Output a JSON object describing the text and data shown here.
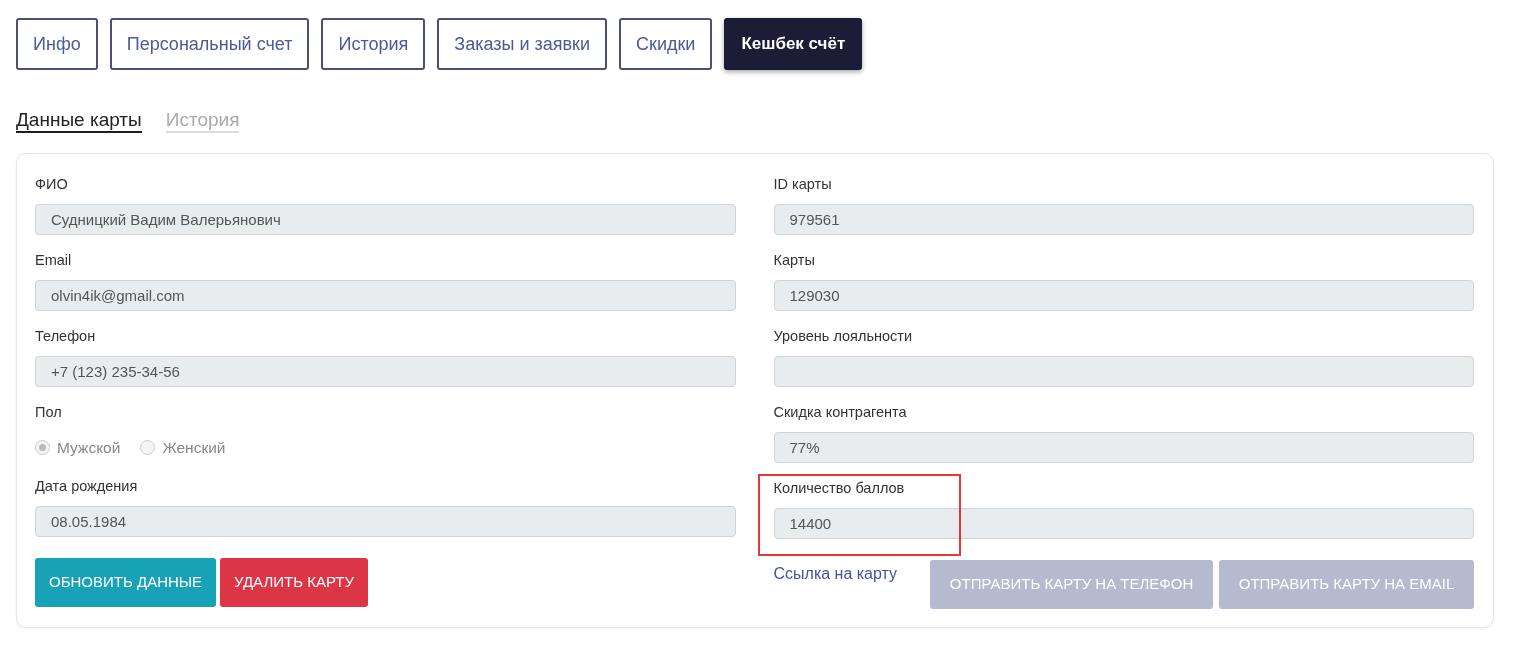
{
  "tabs": [
    {
      "label": "Инфо",
      "selected": false
    },
    {
      "label": "Персональный счет",
      "selected": false
    },
    {
      "label": "История",
      "selected": false
    },
    {
      "label": "Заказы и заявки",
      "selected": false
    },
    {
      "label": "Скидки",
      "selected": false
    },
    {
      "label": "Кешбек счёт",
      "selected": true
    }
  ],
  "subtabs": [
    {
      "label": "Данные карты",
      "selected": true
    },
    {
      "label": "История",
      "selected": false
    }
  ],
  "left_fields": [
    {
      "kind": "text",
      "label": "ФИО",
      "value": "Судницкий Вадим Валерьянович"
    },
    {
      "kind": "text",
      "label": "Email",
      "value": "olvin4ik@gmail.com"
    },
    {
      "kind": "text",
      "label": "Телефон",
      "value": "+7 (123) 235-34-56"
    },
    {
      "kind": "radio",
      "label": "Пол",
      "disabled": true,
      "options": [
        {
          "label": "Мужской",
          "selected": true
        },
        {
          "label": "Женский",
          "selected": false
        }
      ]
    },
    {
      "kind": "text",
      "label": "Дата рождения",
      "value": "08.05.1984"
    }
  ],
  "right_fields": [
    {
      "kind": "text",
      "label": "ID карты",
      "value": "979561"
    },
    {
      "kind": "text",
      "label": "Карты",
      "value": "129030"
    },
    {
      "kind": "text",
      "label": "Уровень лояльности"
    },
    {
      "kind": "text",
      "label": "Скидка контрагента",
      "value": "77%"
    },
    {
      "kind": "text",
      "label": "Количество баллов",
      "value": "14400",
      "highlighted": true
    }
  ],
  "left_buttons": [
    {
      "label": "ОБНОВИТЬ ДАННЫЕ",
      "kind": "info"
    },
    {
      "label": "УДАЛИТЬ КАРТУ",
      "kind": "danger"
    }
  ],
  "card_link": "Ссылка на карту",
  "right_buttons": [
    {
      "label": "ОТПРАВИТЬ КАРТУ НА ТЕЛЕФОН",
      "disabled": true
    },
    {
      "label": "ОТПРАВИТЬ КАРТУ НА EMAIL",
      "disabled": true
    }
  ]
}
